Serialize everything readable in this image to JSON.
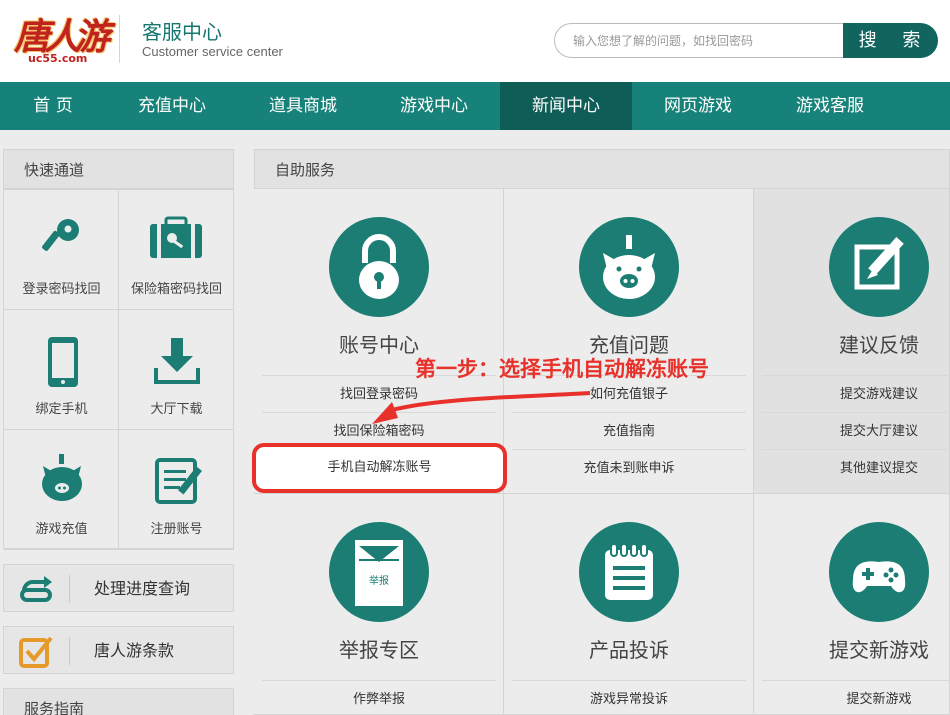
{
  "header": {
    "logo_text": "唐人游",
    "logo_domain": "uc55.com",
    "title": "客服中心",
    "subtitle": "Customer service center",
    "search_placeholder": "输入您想了解的问题，如找回密码",
    "search_button": "搜 索"
  },
  "nav": [
    {
      "label": "首 页"
    },
    {
      "label": "充值中心"
    },
    {
      "label": "道具商城"
    },
    {
      "label": "游戏中心"
    },
    {
      "label": "新闻中心",
      "active": true
    },
    {
      "label": "网页游戏"
    },
    {
      "label": "游戏客服"
    }
  ],
  "sidebar": {
    "quick_title": "快速通道",
    "quick_items": [
      {
        "label": "登录密码找回",
        "icon": "key-icon"
      },
      {
        "label": "保险箱密码找回",
        "icon": "safe-box-icon"
      },
      {
        "label": "绑定手机",
        "icon": "mobile-phone-icon"
      },
      {
        "label": "大厅下载",
        "icon": "download-icon"
      },
      {
        "label": "游戏充值",
        "icon": "piggy-bank-icon"
      },
      {
        "label": "注册账号",
        "icon": "register-edit-icon"
      }
    ],
    "progress_label": "处理进度查询",
    "terms_label": "唐人游条款",
    "guide_title": "服务指南"
  },
  "main": {
    "title": "自助服务",
    "columns": [
      {
        "name": "账号中心",
        "icon": "padlock-icon",
        "links": [
          "找回登录密码",
          "找回保险箱密码",
          "手机自动解冻账号"
        ]
      },
      {
        "name": "充值问题",
        "icon": "piggy-bank-icon",
        "links": [
          "如何充值银子",
          "充值指南",
          "充值未到账申诉"
        ]
      },
      {
        "name": "建议反馈",
        "icon": "edit-note-icon",
        "links": [
          "提交游戏建议",
          "提交大厅建议",
          "其他建议提交"
        ]
      },
      {
        "name": "举报专区",
        "icon": "report-envelope-icon",
        "links": [
          "作弊举报"
        ]
      },
      {
        "name": "产品投诉",
        "icon": "notepad-icon",
        "links": [
          "游戏异常投诉"
        ]
      },
      {
        "name": "提交新游戏",
        "icon": "gamepad-icon",
        "links": [
          "提交新游戏"
        ]
      }
    ],
    "report_icon_text": "举报"
  },
  "annotation": {
    "text": "第一步：选择手机自动解冻账号",
    "color": "#e8312a"
  },
  "colors": {
    "brand_teal": "#178279",
    "nav_active": "#0f5d57",
    "icon_teal": "#1b7d73",
    "annotation_red": "#e8312a"
  }
}
